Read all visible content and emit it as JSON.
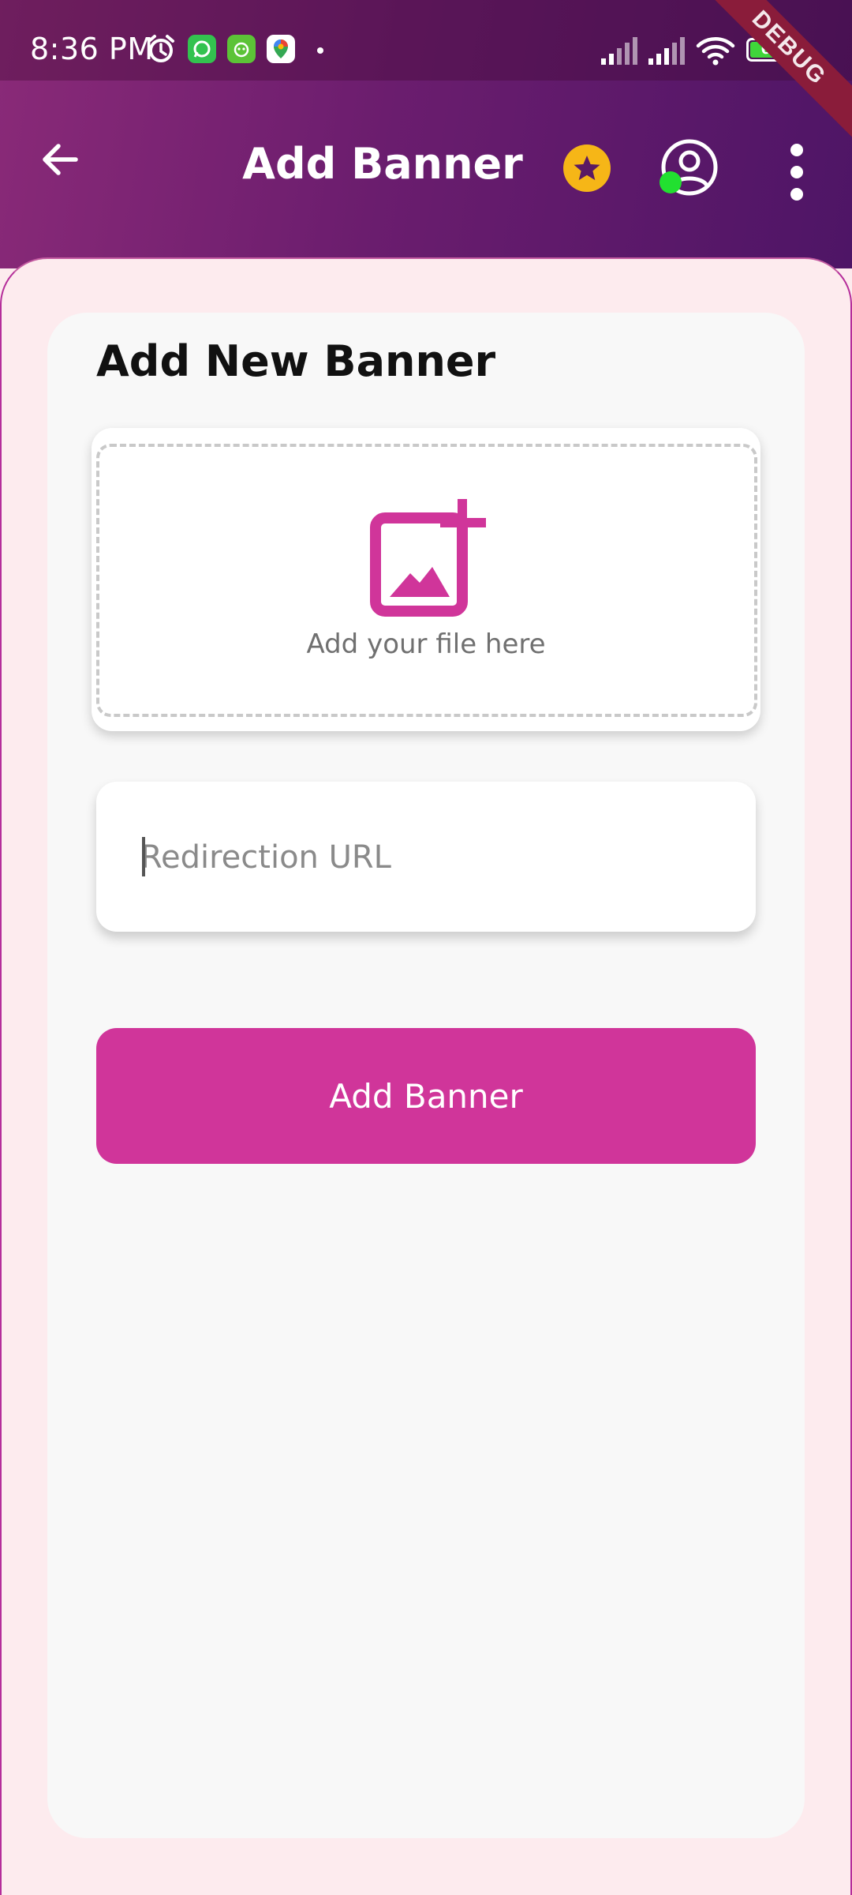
{
  "status_bar": {
    "time": "8:36 PM",
    "battery": "65",
    "debug_banner": "DEBUG",
    "icons": [
      "alarm-icon",
      "whatsapp-icon",
      "app-notification-icon",
      "maps-icon",
      "signal-icon",
      "signal-icon",
      "wifi-icon",
      "battery-icon"
    ]
  },
  "app_bar": {
    "title": "Add Banner",
    "icons": [
      "back-arrow-icon",
      "star-icon",
      "profile-icon",
      "more-vert-icon"
    ]
  },
  "form": {
    "heading": "Add New Banner",
    "upload_label": "Add your file here",
    "url_placeholder": "Redirection URL",
    "url_value": "",
    "submit_label": "Add Banner"
  },
  "colors": {
    "accent": "#d0359a",
    "header_start": "#8a2a78",
    "header_end": "#4e1566",
    "star": "#f6b617",
    "online": "#22e030",
    "sheet_bg": "#fdebee",
    "card_bg": "#f8f8f8"
  }
}
